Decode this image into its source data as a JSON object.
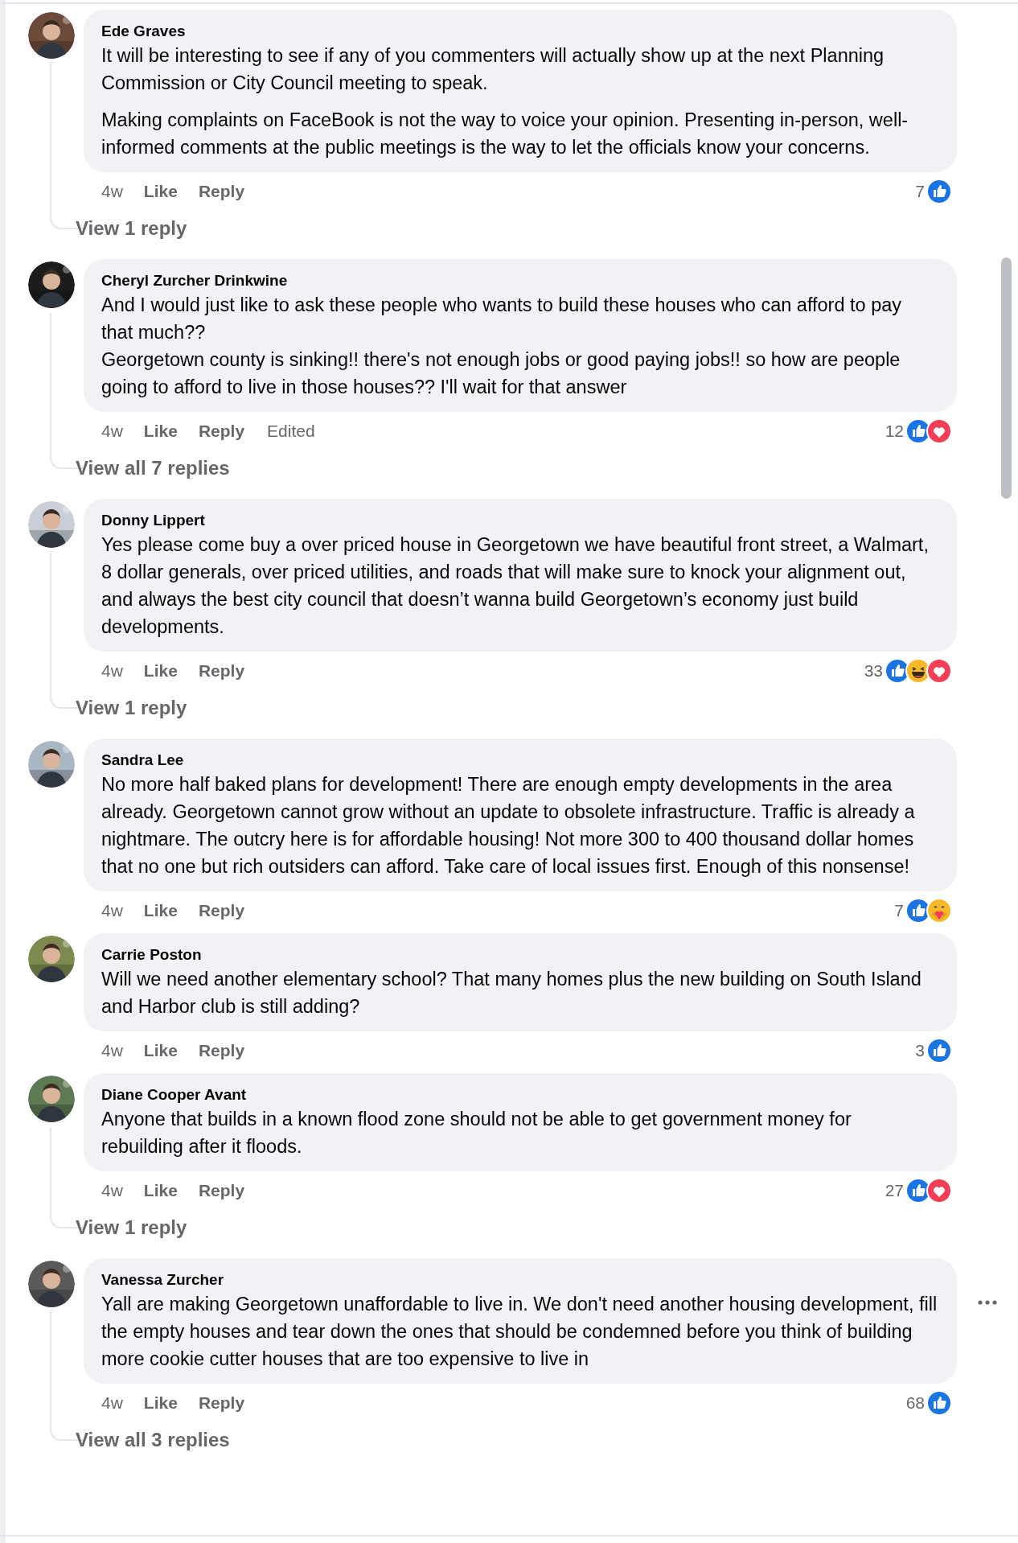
{
  "comments": [
    {
      "author": "Ede Graves",
      "paragraphs": [
        "It will be interesting to see if any of you commenters will actually show up at the next Planning Commission or City Council meeting to speak.",
        "Making complaints on FaceBook is not the way to voice your opinion. Presenting in-person, well-informed comments at the public meetings is the way to let the officials know your concerns."
      ],
      "time": "4w",
      "like": "Like",
      "reply": "Reply",
      "reaction_count": "7",
      "reactions": [
        {
          "kind": "like"
        }
      ],
      "replies_link": "View 1 reply",
      "options_shown": false
    },
    {
      "author": "Cheryl Zurcher Drinkwine",
      "paragraphs": [
        "And I would just like to ask these people who wants to build these houses who can afford to pay that much??\nGeorgetown county is sinking!! there's not enough jobs or good paying jobs!! so how are people going to afford to live in those houses?? I'll wait for that answer"
      ],
      "time": "4w",
      "like": "Like",
      "reply": "Reply",
      "edited": "Edited",
      "reaction_count": "12",
      "reactions": [
        {
          "kind": "like"
        },
        {
          "kind": "love"
        }
      ],
      "replies_link": "View all 7 replies",
      "options_shown": false
    },
    {
      "author": "Donny Lippert",
      "paragraphs": [
        "Yes please come buy a over priced house in Georgetown we have beautiful front street, a Walmart, 8 dollar generals, over priced utilities, and roads that will make sure to knock your alignment out, and always the best city council that doesn’t wanna build Georgetown’s economy just build developments."
      ],
      "time": "4w",
      "like": "Like",
      "reply": "Reply",
      "reaction_count": "33",
      "reactions": [
        {
          "kind": "like"
        },
        {
          "kind": "haha"
        },
        {
          "kind": "love"
        }
      ],
      "replies_link": "View 1 reply",
      "options_shown": false
    },
    {
      "author": "Sandra Lee",
      "paragraphs": [
        "No more half baked plans for development! There are enough empty developments in the area already. Georgetown cannot grow without an update to obsolete infrastructure. Traffic is already a nightmare. The outcry here is for affordable housing! Not more 300 to 400 thousand dollar homes that no one but rich outsiders can afford. Take care of local issues first. Enough of this nonsense!"
      ],
      "time": "4w",
      "like": "Like",
      "reply": "Reply",
      "reaction_count": "7",
      "reactions": [
        {
          "kind": "like"
        },
        {
          "kind": "care"
        }
      ],
      "options_shown": false
    },
    {
      "author": "Carrie Poston",
      "paragraphs": [
        "Will we need another elementary school? That many homes plus the new building on South Island and Harbor club is still adding?"
      ],
      "time": "4w",
      "like": "Like",
      "reply": "Reply",
      "reaction_count": "3",
      "reactions": [
        {
          "kind": "like"
        }
      ],
      "options_shown": false
    },
    {
      "author": "Diane Cooper Avant",
      "paragraphs": [
        "Anyone that builds in a known flood zone should not be able to get government money for rebuilding after it floods."
      ],
      "time": "4w",
      "like": "Like",
      "reply": "Reply",
      "reaction_count": "27",
      "reactions": [
        {
          "kind": "like"
        },
        {
          "kind": "love"
        }
      ],
      "replies_link": "View 1 reply",
      "options_shown": false
    },
    {
      "author": "Vanessa Zurcher",
      "paragraphs": [
        "Yall are making Georgetown unaffordable to live in. We don't need another housing development, fill the empty houses and tear down the ones that should be condemned before you think of building more cookie cutter houses that are too expensive to live in"
      ],
      "time": "4w",
      "like": "Like",
      "reply": "Reply",
      "reaction_count": "68",
      "reactions": [
        {
          "kind": "like"
        }
      ],
      "replies_link": "View all 3 replies",
      "options_shown": true
    }
  ]
}
